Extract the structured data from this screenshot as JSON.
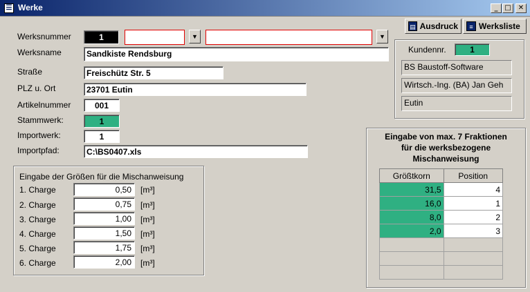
{
  "window": {
    "title": "Werke",
    "minimize": "_",
    "maximize": "□",
    "close": "✕"
  },
  "toolbar": {
    "ausdruck_label": "Ausdruck",
    "werksliste_label": "Werksliste"
  },
  "form": {
    "werksnummer_label": "Werksnummer",
    "werksnummer_value": "1",
    "werksname_label": "Werksname",
    "werksname_value": "Sandkiste Rendsburg",
    "strasse_label": "Straße",
    "strasse_value": "Freischütz Str. 5",
    "plz_ort_label": "PLZ u. Ort",
    "plz_ort_value": "23701 Eutin",
    "artikelnummer_label": "Artikelnummer",
    "artikelnummer_value": "001",
    "stammwerk_label": "Stammwerk:",
    "stammwerk_value": "1",
    "importwerk_label": "Importwerk:",
    "importwerk_value": "1",
    "importpfad_label": "Importpfad:",
    "importpfad_value": "C:\\BS0407.xls"
  },
  "customer": {
    "kundennr_label": "Kundennr.",
    "kundennr_value": "1",
    "line1": "BS Baustoff-Software",
    "line2": "Wirtsch.-Ing. (BA) Jan Geh",
    "line3": "Eutin"
  },
  "mix": {
    "title": "Eingabe der Größen für die Mischanweisung",
    "unit": "[m³]",
    "charges": [
      {
        "label": "1. Charge",
        "value": "0,50"
      },
      {
        "label": "2. Charge",
        "value": "0,75"
      },
      {
        "label": "3. Charge",
        "value": "1,00"
      },
      {
        "label": "4. Charge",
        "value": "1,50"
      },
      {
        "label": "5. Charge",
        "value": "1,75"
      },
      {
        "label": "6. Charge",
        "value": "2,00"
      }
    ]
  },
  "fractions": {
    "title_line1": "Eingabe von max. 7 Fraktionen",
    "title_line2": "für die werksbezogene",
    "title_line3": "Mischanweisung",
    "col_groesstkorn": "Größtkorn",
    "col_position": "Position",
    "rows": [
      {
        "korn": "31,5",
        "pos": "4"
      },
      {
        "korn": "16,0",
        "pos": "1"
      },
      {
        "korn": "8,0",
        "pos": "2"
      },
      {
        "korn": "2,0",
        "pos": "3"
      }
    ]
  },
  "icons": {
    "window": "form-icon",
    "dropdown": "chevron-down-icon",
    "print": "print-icon",
    "list": "list-icon"
  }
}
